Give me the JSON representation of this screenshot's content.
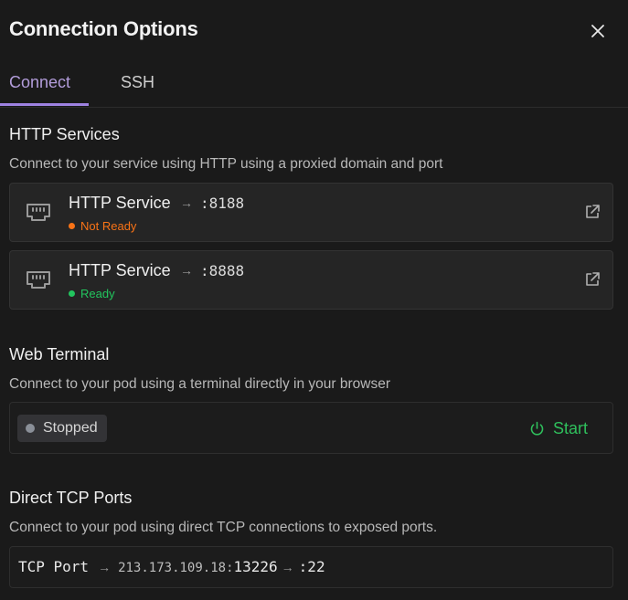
{
  "dialog": {
    "title": "Connection Options",
    "close_icon": "close-icon"
  },
  "tabs": [
    {
      "label": "Connect",
      "active": true
    },
    {
      "label": "SSH",
      "active": false
    }
  ],
  "http": {
    "title": "HTTP Services",
    "description": "Connect to your service using HTTP using a proxied domain and port",
    "services": [
      {
        "name": "HTTP Service",
        "port": ":8188",
        "status": "Not Ready",
        "status_color": "#f97316",
        "icon": "ethernet-port-icon"
      },
      {
        "name": "HTTP Service",
        "port": ":8888",
        "status": "Ready",
        "status_color": "#22c55e",
        "icon": "ethernet-port-icon"
      }
    ],
    "arrow": "→"
  },
  "terminal": {
    "title": "Web Terminal",
    "description": "Connect to your pod using a terminal directly in your browser",
    "status": "Stopped",
    "status_color": "#8a8f98",
    "start_label": "Start",
    "start_color": "#2fbf5c"
  },
  "tcp": {
    "title": "Direct TCP Ports",
    "description": "Connect to your pod using direct TCP connections to exposed ports.",
    "ports": [
      {
        "label": "TCP Port",
        "ip": "213.173.109.18:",
        "public_port": "13226",
        "internal_port": ":22"
      }
    ],
    "arrow": "→"
  },
  "colors": {
    "accent": "#9f83e2",
    "background": "#1a1a1a",
    "card": "#252525"
  }
}
